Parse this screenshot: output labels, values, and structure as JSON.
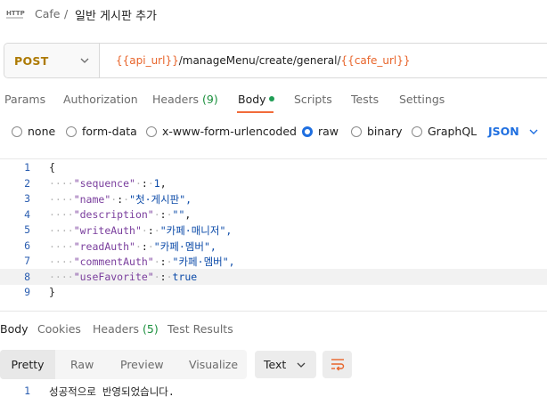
{
  "breadcrumb": {
    "icon": "http-request-icon",
    "parent": "Cafe",
    "separator": "/",
    "title": "일반 게시판 추가"
  },
  "request": {
    "method": "POST",
    "url_parts": [
      {
        "text": "{{api_url}}",
        "kind": "var"
      },
      {
        "text": "/manageMenu/create/general/",
        "kind": "txt"
      },
      {
        "text": "{{cafe_url}}",
        "kind": "var"
      }
    ]
  },
  "request_tabs": {
    "params": "Params",
    "authorization": "Authorization",
    "headers": "Headers",
    "headers_count": "(9)",
    "body": "Body",
    "scripts": "Scripts",
    "tests": "Tests",
    "settings": "Settings"
  },
  "body_types": {
    "none": "none",
    "form_data": "form-data",
    "urlencoded": "x-www-form-urlencoded",
    "raw": "raw",
    "binary": "binary",
    "graphql": "GraphQL",
    "selected": "raw",
    "language": "JSON"
  },
  "editor": {
    "lines": [
      {
        "n": "1",
        "text": "{"
      },
      {
        "n": "2",
        "text": "····\"sequence\"·:·1,"
      },
      {
        "n": "3",
        "text": "····\"name\"·:·\"첫·게시판\","
      },
      {
        "n": "4",
        "text": "····\"description\"·:·\"\","
      },
      {
        "n": "5",
        "text": "····\"writeAuth\"·:·\"카페·매니저\","
      },
      {
        "n": "6",
        "text": "····\"readAuth\"·:·\"카페·멤버\","
      },
      {
        "n": "7",
        "text": "····\"commentAuth\"·:·\"카페·멤버\","
      },
      {
        "n": "8",
        "text": "····\"useFavorite\"·:·true"
      },
      {
        "n": "9",
        "text": "}"
      }
    ]
  },
  "response_tabs": {
    "body": "Body",
    "cookies": "Cookies",
    "headers": "Headers",
    "headers_count": "(5)",
    "test_results": "Test Results"
  },
  "response_view": {
    "pretty": "Pretty",
    "raw": "Raw",
    "preview": "Preview",
    "visualize": "Visualize",
    "format": "Text"
  },
  "response_body": {
    "line_number": "1",
    "text": "성공적으로 반영되었습니다."
  },
  "colors": {
    "accent": "#f26b3a",
    "method": "#ad7a03",
    "variable": "#e8642a",
    "link_blue": "#1f6fe0",
    "status_green": "#1f9d55"
  }
}
